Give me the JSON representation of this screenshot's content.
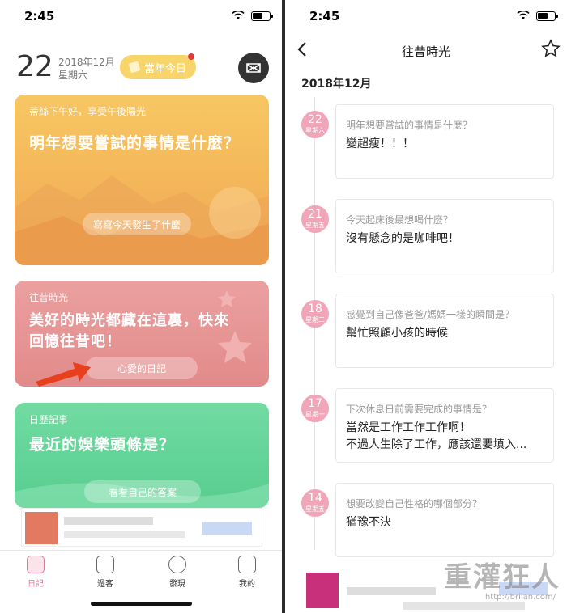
{
  "status": {
    "time": "2:45"
  },
  "left": {
    "header": {
      "day": "22",
      "year_month": "2018年12月",
      "weekday": "星期六",
      "today_label": "當年今日"
    },
    "cards": [
      {
        "small": "蒂絲下午好，享受午後陽光",
        "question": "明年想要嘗試的事情是什麼？",
        "button": "寫寫今天發生了什麼"
      },
      {
        "small": "往昔時光",
        "question_line1": "美好的時光都藏在這裏，快來",
        "question_line2": "回憶往昔吧！",
        "button": "心愛的日記"
      },
      {
        "small": "日歷記事",
        "question": "最近的娛樂頭條是？",
        "button": "看看自己的答案"
      }
    ],
    "tabs": [
      {
        "label": "日記",
        "icon": "diary-icon",
        "active_color": "#e07a9a"
      },
      {
        "label": "過客",
        "icon": "chat-icon"
      },
      {
        "label": "發現",
        "icon": "planet-icon"
      },
      {
        "label": "我的",
        "icon": "face-icon"
      }
    ]
  },
  "right": {
    "nav": {
      "title": "往昔時光",
      "back_icon": "chevron-left-icon",
      "star_icon": "star-outline-icon"
    },
    "month": "2018年12月",
    "entries": [
      {
        "day": "22",
        "weekday": "星期六",
        "question": "明年想要嘗試的事情是什麼？",
        "answer": "變超瘦！！！"
      },
      {
        "day": "21",
        "weekday": "星期五",
        "question": "今天起床後最想喝什麼？",
        "answer": "沒有懸念的是咖啡吧！"
      },
      {
        "day": "18",
        "weekday": "星期二",
        "question": "感覺到自己像爸爸/媽媽一樣的瞬間是？",
        "answer": "幫忙照顧小孩的時候"
      },
      {
        "day": "17",
        "weekday": "星期一",
        "question": "下次休息日前需要完成的事情是？",
        "answer": "當然是工作工作工作啊！\n不過人生除了工作，應該還要填入..."
      },
      {
        "day": "14",
        "weekday": "星期五",
        "question": "想要改變自己性格的哪個部分？",
        "answer": "猶豫不決"
      }
    ],
    "watermark": "重灌狂人",
    "watermark_url": "http://briian.com/"
  },
  "colors": {
    "orange": "#f2b05a",
    "pink": "#e5959a",
    "green": "#62d396",
    "badge": "#f0a6b8"
  }
}
